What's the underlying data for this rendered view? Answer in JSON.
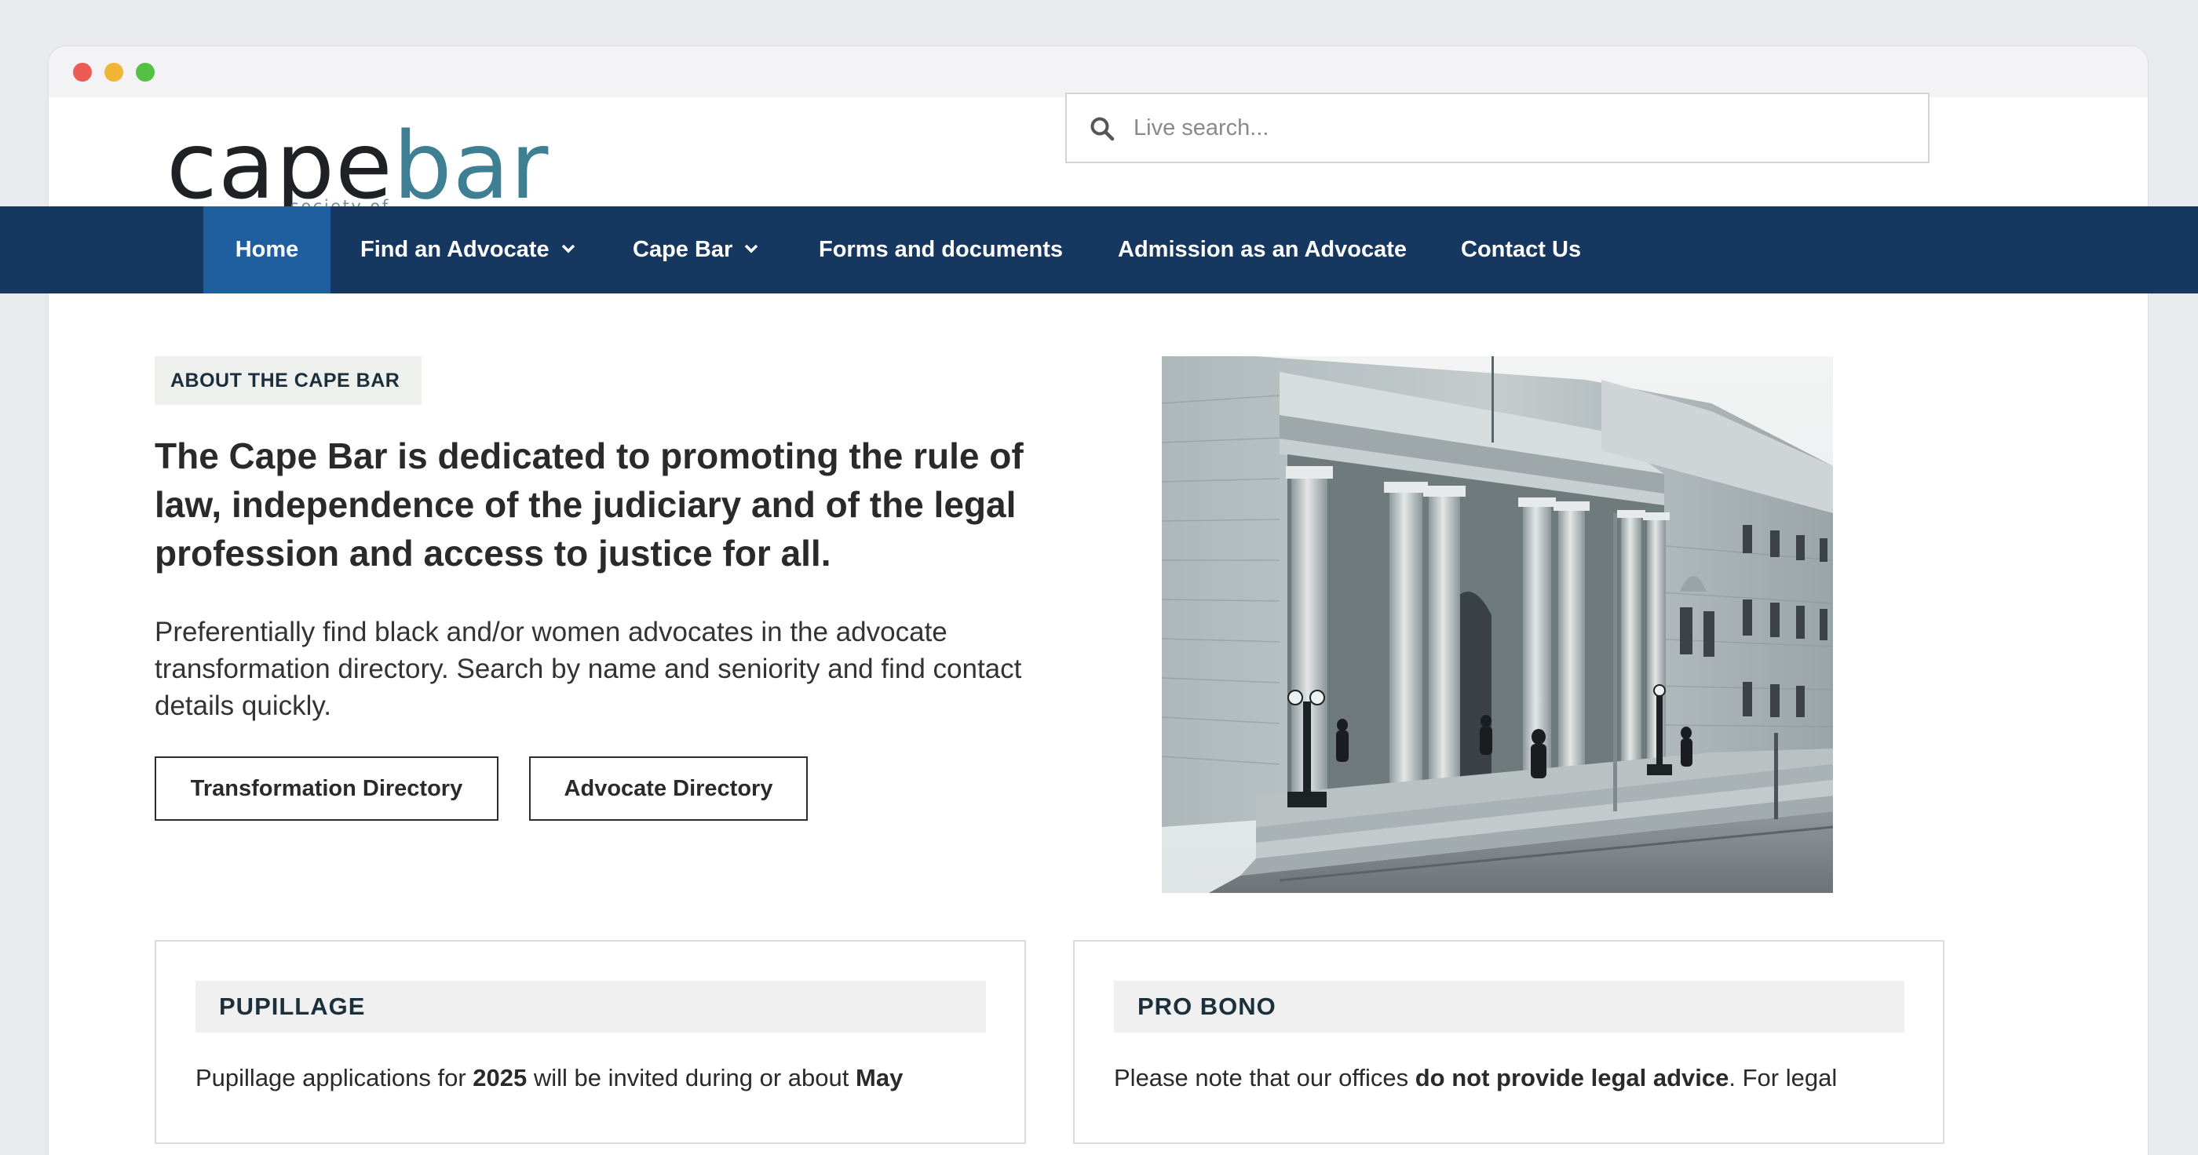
{
  "window": {
    "controls": [
      "close",
      "minimize",
      "zoom"
    ]
  },
  "header": {
    "logo": {
      "word_cape": "cape",
      "word_bar": "bar",
      "tagline": "society of advocates"
    },
    "search": {
      "placeholder": "Live search...",
      "value": "",
      "icon": "search-icon"
    }
  },
  "nav": {
    "items": [
      {
        "label": "Home",
        "active": true
      },
      {
        "label": "Find an Advocate",
        "has_dropdown": true
      },
      {
        "label": "Cape Bar",
        "has_dropdown": true
      },
      {
        "label": "Forms and documents"
      },
      {
        "label": "Admission as an Advocate"
      },
      {
        "label": "Contact Us"
      }
    ]
  },
  "hero": {
    "tag": "ABOUT THE CAPE BAR",
    "headline": "The Cape Bar is dedicated to promoting the rule of law, independence of the judiciary and of the legal profession and access to justice for all.",
    "lead": "Preferentially find black and/or women advocates in the advocate transformation directory. Search by name and seniority and find contact details quickly.",
    "buttons": [
      "Transformation Directory",
      "Advocate Directory"
    ]
  },
  "cards": [
    {
      "title": "PUPILLAGE",
      "text_parts": [
        {
          "text": "Pupillage applications for ",
          "bold": false
        },
        {
          "text": "2025",
          "bold": true
        },
        {
          "text": " will be invited during or about ",
          "bold": false
        },
        {
          "text": "May",
          "bold": true
        }
      ]
    },
    {
      "title": "PRO BONO",
      "text_parts": [
        {
          "text": "Please note that our offices ",
          "bold": false
        },
        {
          "text": "do not provide legal advice",
          "bold": true
        },
        {
          "text": ". For legal",
          "bold": false
        }
      ]
    }
  ],
  "colors": {
    "nav_bg": "#163860",
    "nav_active": "#1f5fa0",
    "logo_accent": "#3f7f93",
    "tag_bg": "#eef0ee"
  }
}
